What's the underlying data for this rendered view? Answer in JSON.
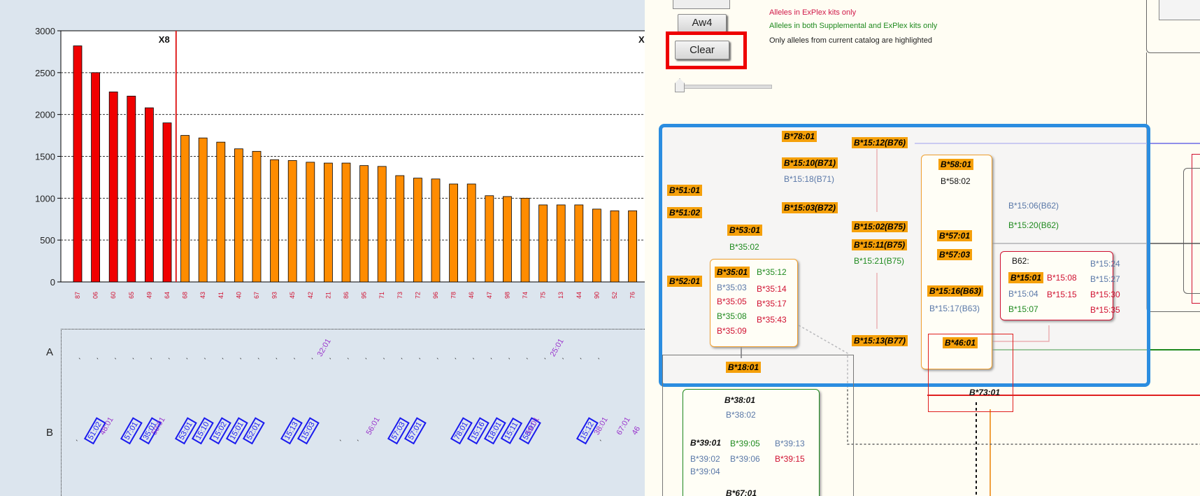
{
  "chart_data": {
    "type": "bar",
    "categories": [
      "87",
      "06",
      "60",
      "65",
      "49",
      "64",
      "68",
      "43",
      "41",
      "40",
      "67",
      "93",
      "45",
      "42",
      "21",
      "86",
      "95",
      "71",
      "73",
      "72",
      "96",
      "78",
      "46",
      "47",
      "98",
      "74",
      "75",
      "13",
      "44",
      "90",
      "52",
      "76"
    ],
    "values": [
      2820,
      2500,
      2270,
      2220,
      2080,
      1900,
      1750,
      1720,
      1670,
      1590,
      1560,
      1460,
      1450,
      1430,
      1420,
      1420,
      1390,
      1380,
      1270,
      1240,
      1230,
      1170,
      1170,
      1030,
      1020,
      1000,
      920,
      920,
      920,
      870,
      850,
      850
    ],
    "highlighted_count": 6,
    "ylim": [
      0,
      3000
    ],
    "yticks": [
      "0",
      "500",
      "1000",
      "1500",
      "2000",
      "2500",
      "3000"
    ],
    "markers": [
      {
        "label": "X8"
      },
      {
        "label": "X"
      }
    ],
    "colors": {
      "highlight": "#f00000",
      "normal": "#ff8c00",
      "marker_line": "#e02020"
    }
  },
  "locus_rows": {
    "A": {
      "label": "A",
      "alleles": [
        "32:01",
        "25:01"
      ]
    },
    "B": {
      "label": "B",
      "boxed": [
        "51:02",
        "57:01",
        "35:01",
        "53:01",
        "15:10",
        "15:02",
        "15:01",
        "52:01",
        "15:13",
        "15:03",
        "57:03",
        "57:01",
        "78:01",
        "15:16",
        "18:01",
        "15:11",
        "58:01",
        "15:12"
      ],
      "plain": [
        "48:01",
        "50:01",
        "56:01",
        "59:01",
        "38:01",
        "67:01",
        "46"
      ]
    }
  },
  "controls": {
    "aw4_label": "Aw4",
    "clear_label": "Clear"
  },
  "legend": {
    "line1": "Alleles in ExPlex kits only",
    "line2": "Alleles in both Supplemental and ExPlex kits only",
    "line3": "Only alleles from current catalog are highlighted"
  },
  "alleles": {
    "b7801": "B*78:01",
    "b1512": "B*15:12(B76)",
    "b1510": "B*15:10(B71)",
    "b1518": "B*15:18(B71)",
    "b5101": "B*51:01",
    "b5102": "B*51:02",
    "b1503": "B*15:03(B72)",
    "b5301": "B*53:01",
    "b3502": "B*35:02",
    "b1502": "B*15:02(B75)",
    "b1511": "B*15:11(B75)",
    "b1521": "B*15:21(B75)",
    "b5801": "B*58:01",
    "b5802": "B*58:02",
    "b5701": "B*57:01",
    "b5703": "B*57:03",
    "b1506": "B*15:06(B62)",
    "b1520": "B*15:20(B62)",
    "b5201": "B*52:01",
    "b3501": "B*35:01",
    "b3512": "B*35:12",
    "b3503": "B*35:03",
    "b3514": "B*35:14",
    "b3505": "B*35:05",
    "b3517": "B*35:17",
    "b3508": "B*35:08",
    "b3543": "B*35:43",
    "b3509": "B*35:09",
    "b1516": "B*15:16(B63)",
    "b1517": "B*15:17(B63)",
    "b62": "B62:",
    "b1501": "B*15:01",
    "b1508": "B*15:08",
    "b1524": "B*15:24",
    "b1527": "B*15:27",
    "b1504": "B*15:04",
    "b1515": "B*15:15",
    "b1530": "B*15:30",
    "b1507": "B*15:07",
    "b1535": "B*15:35",
    "b1513": "B*15:13(B77)",
    "b4601": "B*46:01",
    "b1801": "B*18:01",
    "b7301": "B*73:01",
    "b3801": "B*38:01",
    "b3802": "B*38:02",
    "b3901": "B*39:01",
    "b3905": "B*39:05",
    "b3913": "B*39:13",
    "b3902": "B*39:02",
    "b3906": "B*39:06",
    "b3915": "B*39:15",
    "b3904": "B*39:04",
    "b6701": "B*67:01"
  }
}
